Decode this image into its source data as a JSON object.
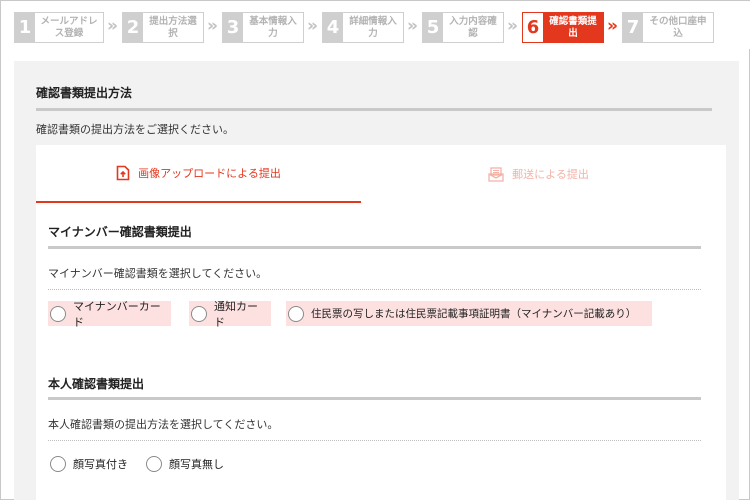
{
  "steps": [
    {
      "num": "1",
      "label": "メールアドレス登録"
    },
    {
      "num": "2",
      "label": "提出方法選択"
    },
    {
      "num": "3",
      "label": "基本情報入力"
    },
    {
      "num": "4",
      "label": "詳細情報入力"
    },
    {
      "num": "5",
      "label": "入力内容確認"
    },
    {
      "num": "6",
      "label": "確認書類提出",
      "active": true
    },
    {
      "num": "7",
      "label": "その他口座申込"
    }
  ],
  "section": {
    "title": "確認書類提出方法",
    "description": "確認書類の提出方法をご選択ください。"
  },
  "tabs": {
    "upload": {
      "label": "画像アップロードによる提出",
      "icon": "upload-file-icon"
    },
    "mail": {
      "label": "郵送による提出",
      "icon": "mail-icon"
    }
  },
  "mynumber": {
    "title": "マイナンバー確認書類提出",
    "description": "マイナンバー確認書類を選択してください。",
    "options": [
      "マイナンバーカード",
      "通知カード",
      "住民票の写しまたは住民票記載事項証明書（マイナンバー記載あり）"
    ]
  },
  "identity": {
    "title": "本人確認書類提出",
    "description": "本人確認書類の提出方法を選択してください。",
    "options": [
      "顔写真付き",
      "顔写真無し"
    ]
  },
  "colors": {
    "accent": "#e3371e",
    "accent_light": "#fde1e1",
    "inactive_step": "#cfcfcf",
    "panel_bg": "#f2f2f2"
  }
}
